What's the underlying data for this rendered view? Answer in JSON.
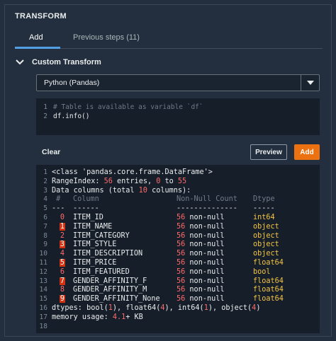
{
  "panel": {
    "title": "TRANSFORM"
  },
  "tabs": [
    {
      "label": "Add",
      "active": true
    },
    {
      "label": "Previous steps (11)",
      "active": false
    }
  ],
  "section": {
    "title": "Custom Transform",
    "expanded": true
  },
  "language_select": {
    "value": "Python (Pandas)"
  },
  "editor": {
    "lines": [
      {
        "num": "1",
        "text": "# Table is available as variable `df`"
      },
      {
        "num": "2",
        "text": "df.info()"
      }
    ]
  },
  "toolbar": {
    "clear_label": "Clear",
    "preview_label": "Preview",
    "add_label": "Add"
  },
  "output": {
    "header": [
      {
        "num": "1",
        "text": "<class 'pandas.core.frame.DataFrame'>"
      },
      {
        "num": "2",
        "p1": "RangeIndex: ",
        "n1": "56",
        "p2": " entries, ",
        "n2": "0",
        "p3": " to ",
        "n3": "55"
      },
      {
        "num": "3",
        "p1": "Data columns (total ",
        "n1": "10",
        "p2": " columns):"
      },
      {
        "num": "4",
        "idx": " #",
        "col": "Column",
        "nn": "Non-Null Count",
        "dt": "Dtype"
      },
      {
        "num": "5",
        "idx": "---",
        "col": "------",
        "nn": "--------------",
        "dt": "-----"
      }
    ],
    "rows": [
      {
        "num": "6",
        "idx": "0",
        "col": "ITEM_ID",
        "count": "56",
        "nn": "non-null",
        "dt": "int64",
        "hl": false
      },
      {
        "num": "7",
        "idx": "1",
        "col": "ITEM_NAME",
        "count": "56",
        "nn": "non-null",
        "dt": "object",
        "hl": true
      },
      {
        "num": "8",
        "idx": "2",
        "col": "ITEM_CATEGORY",
        "count": "56",
        "nn": "non-null",
        "dt": "object",
        "hl": false
      },
      {
        "num": "9",
        "idx": "3",
        "col": "ITEM_STYLE",
        "count": "56",
        "nn": "non-null",
        "dt": "object",
        "hl": true
      },
      {
        "num": "10",
        "idx": "4",
        "col": "ITEM_DESCRIPTION",
        "count": "56",
        "nn": "non-null",
        "dt": "object",
        "hl": false
      },
      {
        "num": "11",
        "idx": "5",
        "col": "ITEM_PRICE",
        "count": "56",
        "nn": "non-null",
        "dt": "float64",
        "hl": true
      },
      {
        "num": "12",
        "idx": "6",
        "col": "ITEM_FEATURED",
        "count": "56",
        "nn": "non-null",
        "dt": "bool",
        "hl": false
      },
      {
        "num": "13",
        "idx": "7",
        "col": "GENDER_AFFINITY_F",
        "count": "56",
        "nn": "non-null",
        "dt": "float64",
        "hl": true
      },
      {
        "num": "14",
        "idx": "8",
        "col": "GENDER_AFFINITY_M",
        "count": "56",
        "nn": "non-null",
        "dt": "float64",
        "hl": false
      },
      {
        "num": "15",
        "idx": "9",
        "col": "GENDER_AFFINITY_None",
        "count": "56",
        "nn": "non-null",
        "dt": "float64",
        "hl": true
      }
    ],
    "footer": {
      "dtypes": {
        "num": "16",
        "p1": "dtypes: bool(",
        "n1": "1",
        "p2": "), float64(",
        "n2": "4",
        "p3": "), int64(",
        "n3": "1",
        "p4": "), object(",
        "n4": "4",
        "p5": ")"
      },
      "memory": {
        "num": "17",
        "p1": "memory usage: ",
        "n1": "4.1",
        "p2": "+ KB"
      },
      "blank": {
        "num": "18"
      }
    }
  },
  "colors": {
    "background": "#232f3e",
    "accent_orange": "#ec7211",
    "tab_underline": "#539fe5",
    "number_red": "#ff6b6b",
    "dtype_yellow": "#f4c542"
  }
}
